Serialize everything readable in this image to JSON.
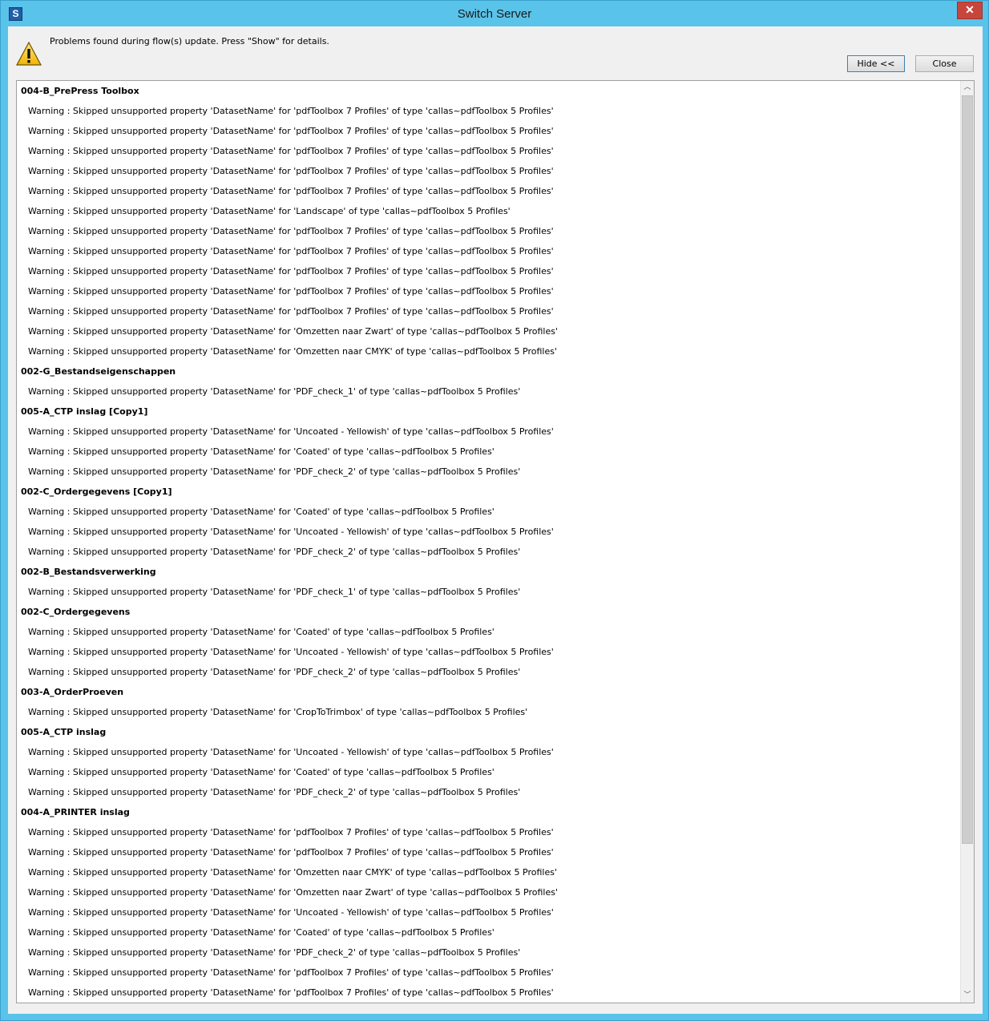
{
  "window": {
    "title": "Switch Server",
    "app_icon_letter": "S",
    "close_glyph": "✕"
  },
  "dialog": {
    "message": "Problems found during flow(s) update. Press \"Show\" for details.",
    "warning_icon": "warning-triangle-icon",
    "hide_label": "Hide <<",
    "close_label": "Close"
  },
  "details": {
    "groups": [
      {
        "name": "004-B_PrePress Toolbox",
        "warnings": [
          "Warning : Skipped unsupported property 'DatasetName' for 'pdfToolbox 7 Profiles' of type 'callas~pdfToolbox 5 Profiles'",
          "Warning : Skipped unsupported property 'DatasetName' for 'pdfToolbox 7 Profiles' of type 'callas~pdfToolbox 5 Profiles'",
          "Warning : Skipped unsupported property 'DatasetName' for 'pdfToolbox 7 Profiles' of type 'callas~pdfToolbox 5 Profiles'",
          "Warning : Skipped unsupported property 'DatasetName' for 'pdfToolbox 7 Profiles' of type 'callas~pdfToolbox 5 Profiles'",
          "Warning : Skipped unsupported property 'DatasetName' for 'pdfToolbox 7 Profiles' of type 'callas~pdfToolbox 5 Profiles'",
          "Warning : Skipped unsupported property 'DatasetName' for 'Landscape' of type 'callas~pdfToolbox 5 Profiles'",
          "Warning : Skipped unsupported property 'DatasetName' for 'pdfToolbox 7 Profiles' of type 'callas~pdfToolbox 5 Profiles'",
          "Warning : Skipped unsupported property 'DatasetName' for 'pdfToolbox 7 Profiles' of type 'callas~pdfToolbox 5 Profiles'",
          "Warning : Skipped unsupported property 'DatasetName' for 'pdfToolbox 7 Profiles' of type 'callas~pdfToolbox 5 Profiles'",
          "Warning : Skipped unsupported property 'DatasetName' for 'pdfToolbox 7 Profiles' of type 'callas~pdfToolbox 5 Profiles'",
          "Warning : Skipped unsupported property 'DatasetName' for 'pdfToolbox 7 Profiles' of type 'callas~pdfToolbox 5 Profiles'",
          "Warning : Skipped unsupported property 'DatasetName' for 'Omzetten naar Zwart' of type 'callas~pdfToolbox 5 Profiles'",
          "Warning : Skipped unsupported property 'DatasetName' for 'Omzetten naar CMYK' of type 'callas~pdfToolbox 5 Profiles'"
        ]
      },
      {
        "name": "002-G_Bestandseigenschappen",
        "warnings": [
          "Warning : Skipped unsupported property 'DatasetName' for 'PDF_check_1' of type 'callas~pdfToolbox 5 Profiles'"
        ]
      },
      {
        "name": "005-A_CTP inslag [Copy1]",
        "warnings": [
          "Warning : Skipped unsupported property 'DatasetName' for 'Uncoated - Yellowish' of type 'callas~pdfToolbox 5 Profiles'",
          "Warning : Skipped unsupported property 'DatasetName' for 'Coated' of type 'callas~pdfToolbox 5 Profiles'",
          "Warning : Skipped unsupported property 'DatasetName' for 'PDF_check_2' of type 'callas~pdfToolbox 5 Profiles'"
        ]
      },
      {
        "name": "002-C_Ordergegevens [Copy1]",
        "warnings": [
          "Warning : Skipped unsupported property 'DatasetName' for 'Coated' of type 'callas~pdfToolbox 5 Profiles'",
          "Warning : Skipped unsupported property 'DatasetName' for 'Uncoated - Yellowish' of type 'callas~pdfToolbox 5 Profiles'",
          "Warning : Skipped unsupported property 'DatasetName' for 'PDF_check_2' of type 'callas~pdfToolbox 5 Profiles'"
        ]
      },
      {
        "name": "002-B_Bestandsverwerking",
        "warnings": [
          "Warning : Skipped unsupported property 'DatasetName' for 'PDF_check_1' of type 'callas~pdfToolbox 5 Profiles'"
        ]
      },
      {
        "name": "002-C_Ordergegevens",
        "warnings": [
          "Warning : Skipped unsupported property 'DatasetName' for 'Coated' of type 'callas~pdfToolbox 5 Profiles'",
          "Warning : Skipped unsupported property 'DatasetName' for 'Uncoated - Yellowish' of type 'callas~pdfToolbox 5 Profiles'",
          "Warning : Skipped unsupported property 'DatasetName' for 'PDF_check_2' of type 'callas~pdfToolbox 5 Profiles'"
        ]
      },
      {
        "name": "003-A_OrderProeven",
        "warnings": [
          "Warning : Skipped unsupported property 'DatasetName' for 'CropToTrimbox' of type 'callas~pdfToolbox 5 Profiles'"
        ]
      },
      {
        "name": "005-A_CTP inslag",
        "warnings": [
          "Warning : Skipped unsupported property 'DatasetName' for 'Uncoated - Yellowish' of type 'callas~pdfToolbox 5 Profiles'",
          "Warning : Skipped unsupported property 'DatasetName' for 'Coated' of type 'callas~pdfToolbox 5 Profiles'",
          "Warning : Skipped unsupported property 'DatasetName' for 'PDF_check_2' of type 'callas~pdfToolbox 5 Profiles'"
        ]
      },
      {
        "name": "004-A_PRINTER inslag",
        "warnings": [
          "Warning : Skipped unsupported property 'DatasetName' for 'pdfToolbox 7 Profiles' of type 'callas~pdfToolbox 5 Profiles'",
          "Warning : Skipped unsupported property 'DatasetName' for 'pdfToolbox 7 Profiles' of type 'callas~pdfToolbox 5 Profiles'",
          "Warning : Skipped unsupported property 'DatasetName' for 'Omzetten naar CMYK' of type 'callas~pdfToolbox 5 Profiles'",
          "Warning : Skipped unsupported property 'DatasetName' for 'Omzetten naar Zwart' of type 'callas~pdfToolbox 5 Profiles'",
          "Warning : Skipped unsupported property 'DatasetName' for 'Uncoated - Yellowish' of type 'callas~pdfToolbox 5 Profiles'",
          "Warning : Skipped unsupported property 'DatasetName' for 'Coated' of type 'callas~pdfToolbox 5 Profiles'",
          "Warning : Skipped unsupported property 'DatasetName' for 'PDF_check_2' of type 'callas~pdfToolbox 5 Profiles'",
          "Warning : Skipped unsupported property 'DatasetName' for 'pdfToolbox 7 Profiles' of type 'callas~pdfToolbox 5 Profiles'",
          "Warning : Skipped unsupported property 'DatasetName' for 'pdfToolbox 7 Profiles' of type 'callas~pdfToolbox 5 Profiles'"
        ]
      }
    ]
  },
  "scrollbar": {
    "up_glyph": "︿",
    "down_glyph": "﹀"
  },
  "colors": {
    "titlebar": "#5ac3ea",
    "close_button": "#c7463c",
    "dialog_background": "#f0f0f0"
  }
}
